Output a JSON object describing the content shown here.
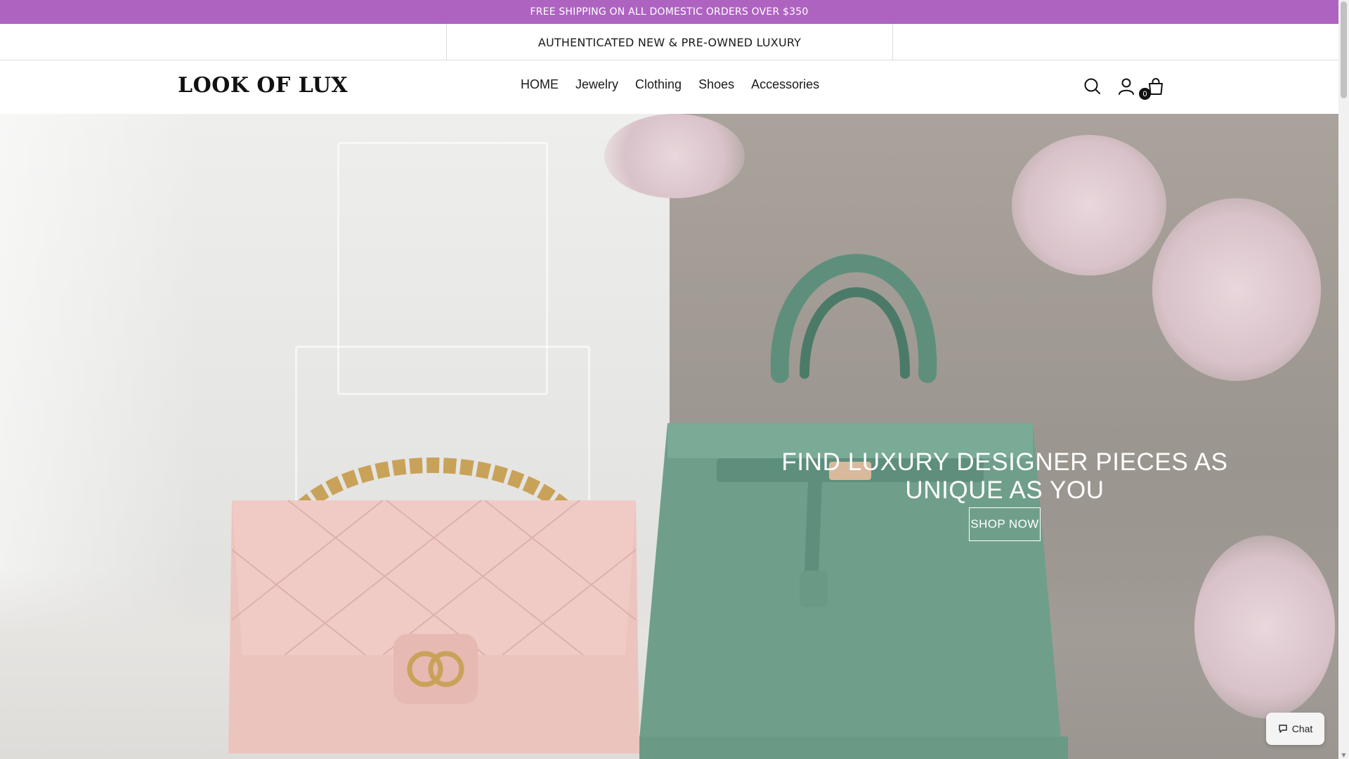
{
  "promo": {
    "text": "FREE SHIPPING ON ALL DOMESTIC ORDERS OVER $350"
  },
  "strip": {
    "text": "AUTHENTICATED NEW & PRE-OWNED LUXURY"
  },
  "header": {
    "logo": "LOOK OF LUX",
    "nav": [
      "HOME",
      "Jewelry",
      "Clothing",
      "Shoes",
      "Accessories"
    ],
    "icons": [
      "search-icon",
      "account-icon",
      "cart-icon"
    ],
    "cart_count": "0"
  },
  "hero": {
    "title_line1": "FIND LUXURY DESIGNER PIECES AS",
    "title_line2": "UNIQUE AS YOU",
    "cta": "SHOP NOW"
  },
  "chat": {
    "label": "Chat",
    "icon": "chat-bubble-icon"
  },
  "colors": {
    "promo_bg": "#ae63c1",
    "text": "#111111",
    "white": "#ffffff"
  }
}
